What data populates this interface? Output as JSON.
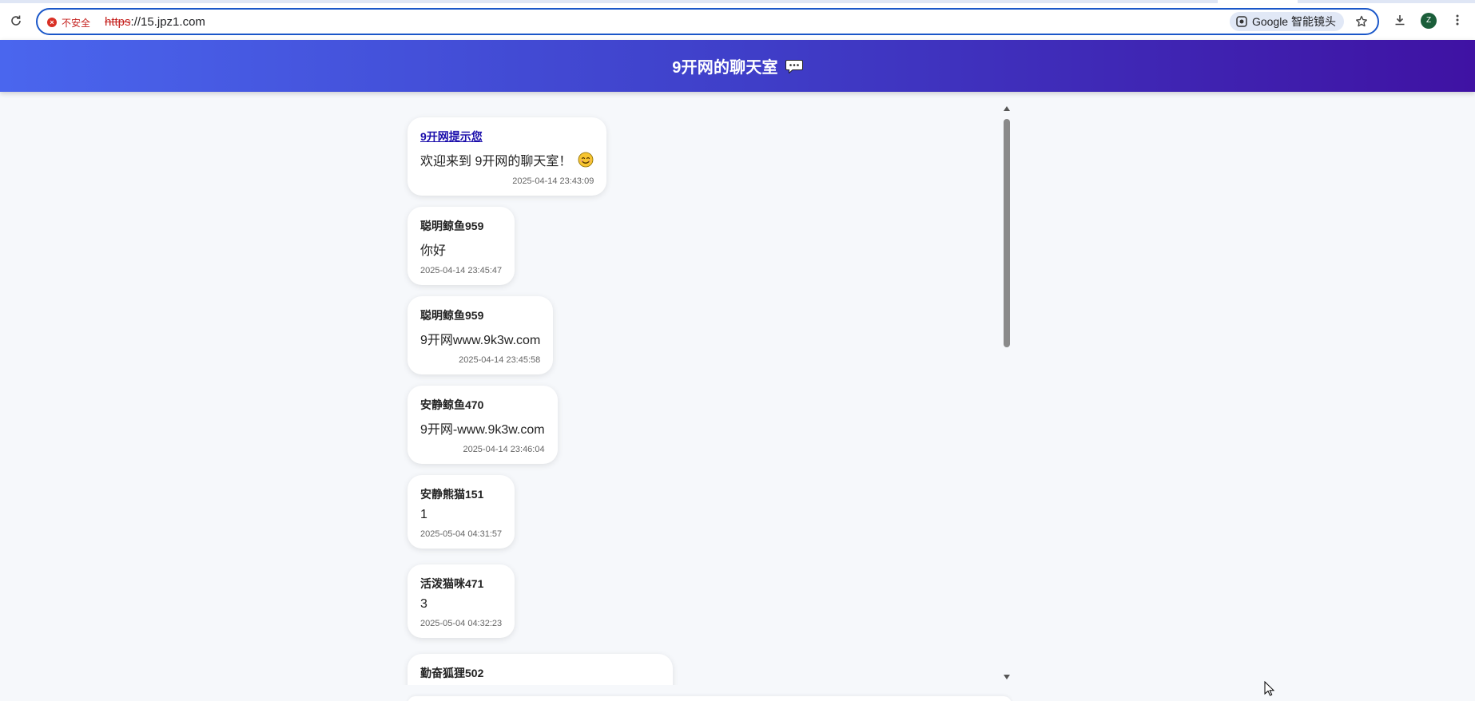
{
  "browser": {
    "security_label": "不安全",
    "url_scheme": "https",
    "url_rest": "://15.jpz1.com",
    "lens_label": "Google 智能镜头",
    "avatar_letter": "Z",
    "icons": [
      "reload-icon",
      "not-secure-icon",
      "lens-icon",
      "star-icon",
      "download-icon",
      "more-icon"
    ]
  },
  "header": {
    "title": "9开网的聊天室",
    "icon": "speech-bubble-icon",
    "gradient": [
      "#4a66ee",
      "#3f12a3"
    ]
  },
  "messages": [
    {
      "sender": "9开网提示您",
      "sender_is_link": true,
      "text": "欢迎来到 9开网的聊天室！",
      "emoji": "smiling-face-icon",
      "time": "2025-04-14 23:43:09"
    },
    {
      "sender": "聪明鲸鱼959",
      "text": "你好",
      "time": "2025-04-14 23:45:47"
    },
    {
      "sender": "聪明鲸鱼959",
      "text": "9开网www.9k3w.com",
      "time": "2025-04-14 23:45:58"
    },
    {
      "sender": "安静鲸鱼470",
      "text": "9开网-www.9k3w.com",
      "time": "2025-04-14 23:46:04"
    },
    {
      "sender": "安静熊猫151",
      "text": "1",
      "time": "2025-05-04 04:31:57"
    },
    {
      "sender": "活泼猫咪471",
      "text": "3",
      "time": "2025-05-04 04:32:23"
    },
    {
      "sender": "勤奋狐狸502",
      "text": "",
      "time": ""
    }
  ]
}
